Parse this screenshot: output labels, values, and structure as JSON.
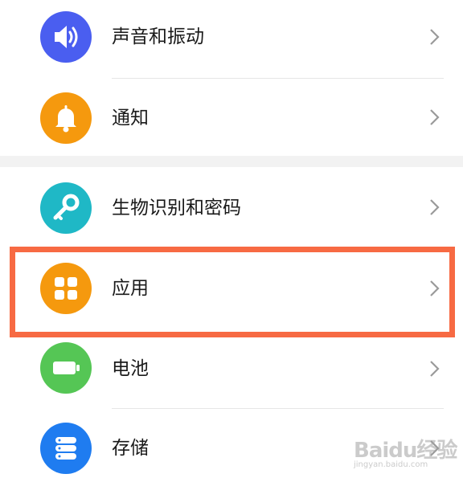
{
  "colors": {
    "sound": "#4a5ef0",
    "notification": "#f5990e",
    "biometrics": "#1fb8c6",
    "apps": "#f5990e",
    "battery": "#55c655",
    "storage": "#1f7cf0",
    "highlight_border": "#f76a43"
  },
  "settings": {
    "items": [
      {
        "label": "声音和振动",
        "icon": "speaker-icon"
      },
      {
        "label": "通知",
        "icon": "bell-icon"
      },
      {
        "label": "生物识别和密码",
        "icon": "key-icon"
      },
      {
        "label": "应用",
        "icon": "apps-grid-icon"
      },
      {
        "label": "电池",
        "icon": "battery-icon"
      },
      {
        "label": "存储",
        "icon": "storage-icon"
      }
    ]
  },
  "watermark": {
    "main": "Baidu经验",
    "sub": "jingyan.baidu.com"
  }
}
